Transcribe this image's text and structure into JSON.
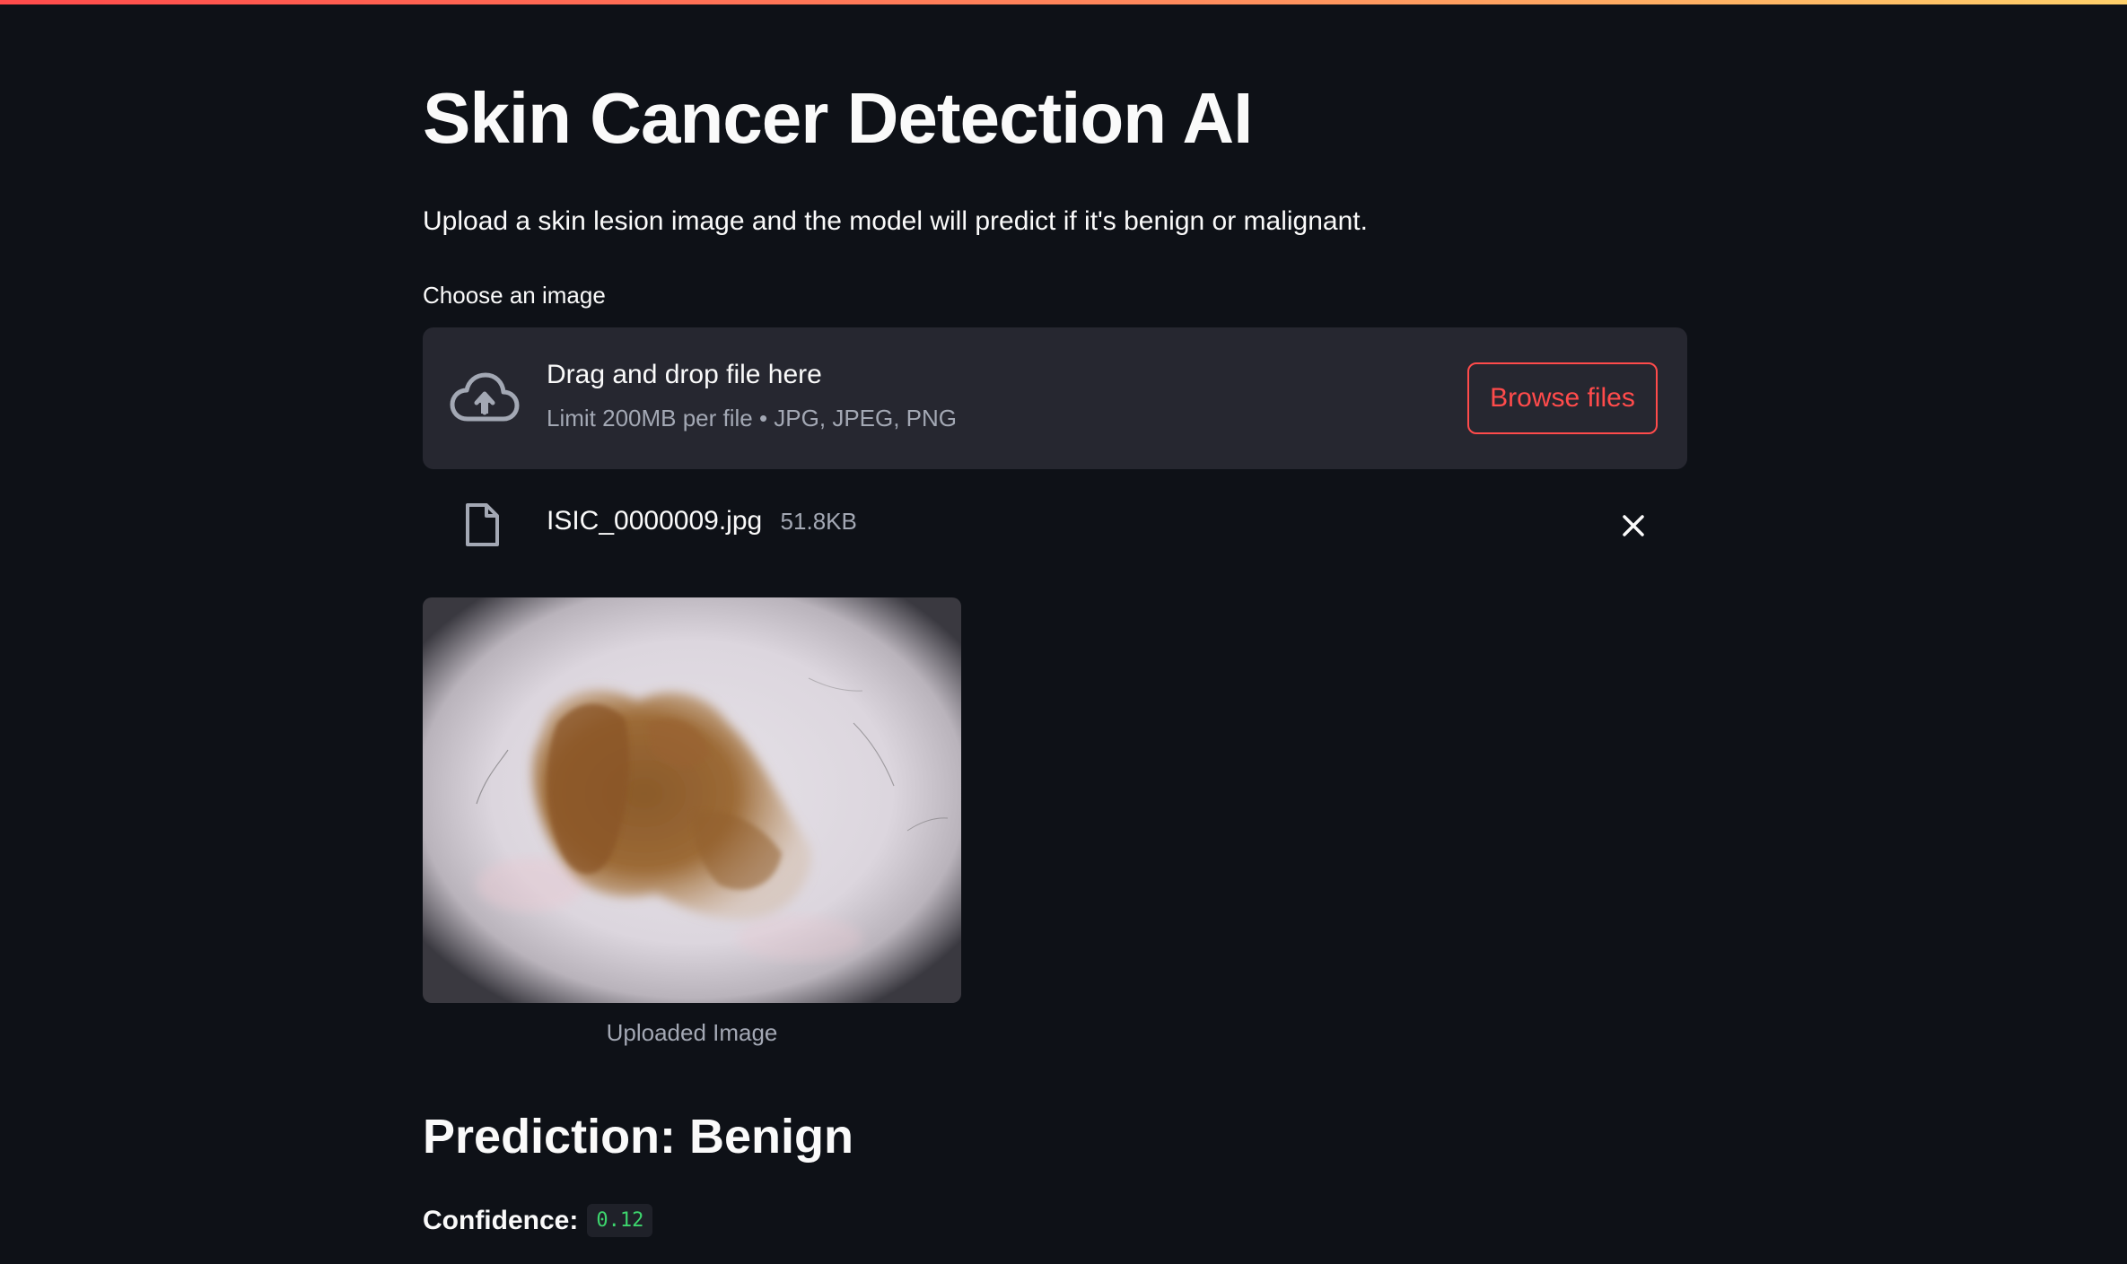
{
  "app": {
    "title": "Skin Cancer Detection AI",
    "description": "Upload a skin lesion image and the model will predict if it's benign or malignant."
  },
  "uploader": {
    "label": "Choose an image",
    "drop_title": "Drag and drop file here",
    "limit_text": "Limit 200MB per file • JPG, JPEG, PNG",
    "browse_label": "Browse files",
    "upload_icon": "cloud-upload-icon"
  },
  "uploaded_file": {
    "name": "ISIC_0000009.jpg",
    "size": "51.8KB",
    "file_icon": "file-icon",
    "remove_icon": "close-icon"
  },
  "image": {
    "caption": "Uploaded Image"
  },
  "result": {
    "prediction": "Prediction: Benign",
    "confidence_label": "Confidence:",
    "confidence_value": "0.12"
  },
  "colors": {
    "background": "#0e1117",
    "panel": "#262730",
    "accent": "#ff4b4b",
    "code_text": "#3dd56d"
  }
}
